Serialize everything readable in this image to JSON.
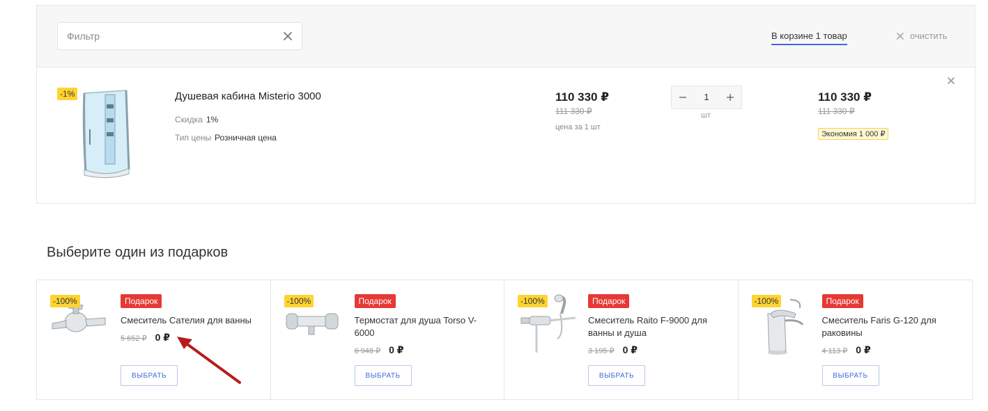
{
  "filter": {
    "placeholder": "Фильтр",
    "value": ""
  },
  "header": {
    "in_cart": "В корзине 1 товар",
    "clear": "очистить"
  },
  "cart_item": {
    "discount_badge": "-1%",
    "name_prefix": "Душевая кабина ",
    "name_brand": "Misterio 3000",
    "discount_label": "Скидка",
    "discount_value": "1%",
    "price_type_label": "Тип цены",
    "price_type_value": "Розничная цена",
    "unit_price": "110 330 ₽",
    "unit_price_old": "111 330 ₽",
    "unit_note": "цена за 1 шт",
    "quantity": "1",
    "quantity_unit": "шт",
    "total_price": "110 330 ₽",
    "total_price_old": "111 330 ₽",
    "saving": "Экономия 1 000 ₽"
  },
  "gifts": {
    "title": "Выберите один из подарков",
    "items": [
      {
        "badge": "-100%",
        "label": "Подарок",
        "name": "Смеситель Сателия для ванны",
        "old_price": "5 652 ₽",
        "price": "0 ₽",
        "button": "ВЫБРАТЬ",
        "icon": "bath-mixer-icon"
      },
      {
        "badge": "-100%",
        "label": "Подарок",
        "name": "Термостат для душа Torso V-6000",
        "old_price": "6 948 ₽",
        "price": "0 ₽",
        "button": "ВЫБРАТЬ",
        "icon": "thermostat-icon"
      },
      {
        "badge": "-100%",
        "label": "Подарок",
        "name": "Смеситель Raito F-9000 для ванны и душа",
        "old_price": "3 195 ₽",
        "price": "0 ₽",
        "button": "ВЫБРАТЬ",
        "icon": "shower-mixer-icon"
      },
      {
        "badge": "-100%",
        "label": "Подарок",
        "name": "Смеситель Faris G-120 для раковины",
        "old_price": "4 113 ₽",
        "price": "0 ₽",
        "button": "ВЫБРАТЬ",
        "icon": "basin-mixer-icon"
      }
    ]
  },
  "colors": {
    "accent": "#3f6ad8",
    "badge": "#ffd332",
    "gift": "#e53935",
    "arrow": "#b71c1c"
  }
}
